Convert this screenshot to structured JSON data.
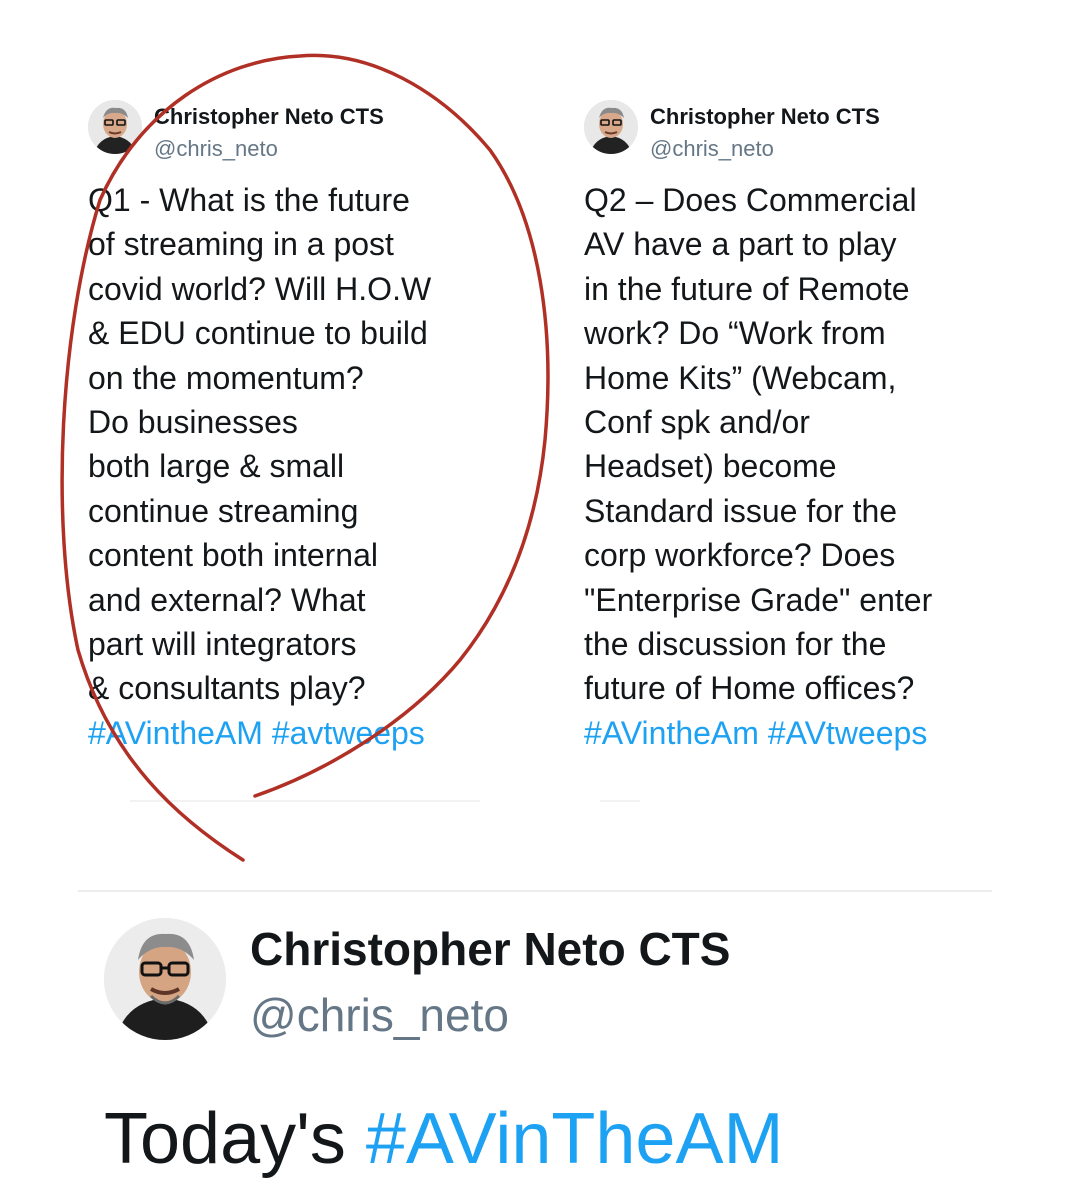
{
  "tweets": [
    {
      "name": "Christopher Neto CTS",
      "handle": "@chris_neto",
      "lines": [
        "Q1 - What is the future",
        "of streaming in a post",
        "covid world? Will H.O.W",
        "& EDU continue to build",
        "on the momentum?",
        "Do businesses",
        "both large & small",
        "continue streaming",
        "content both internal",
        "and external? What",
        "part will integrators",
        "& consultants play?"
      ],
      "hashtags": "#AVintheAM #avtweeps"
    },
    {
      "name": "Christopher Neto CTS",
      "handle": "@chris_neto",
      "lines": [
        "Q2 – Does Commercial",
        "AV have a part to play",
        "in the future of Remote",
        "work? Do “Work from",
        "Home Kits” (Webcam,",
        "Conf spk and/or",
        "Headset) become",
        "Standard issue for the",
        "corp workforce? Does",
        "\"Enterprise Grade\" enter",
        "the discussion for the",
        "future of Home offices?"
      ],
      "hashtags": "#AVintheAm #AVtweeps"
    }
  ],
  "main_tweet": {
    "name": "Christopher Neto CTS",
    "handle": "@chris_neto",
    "text_prefix": "Today's ",
    "text_hashtag": "#AVinTheAM"
  },
  "colors": {
    "hashtag": "#1da1f2",
    "handle": "#657786",
    "annotation": "#b03026"
  }
}
